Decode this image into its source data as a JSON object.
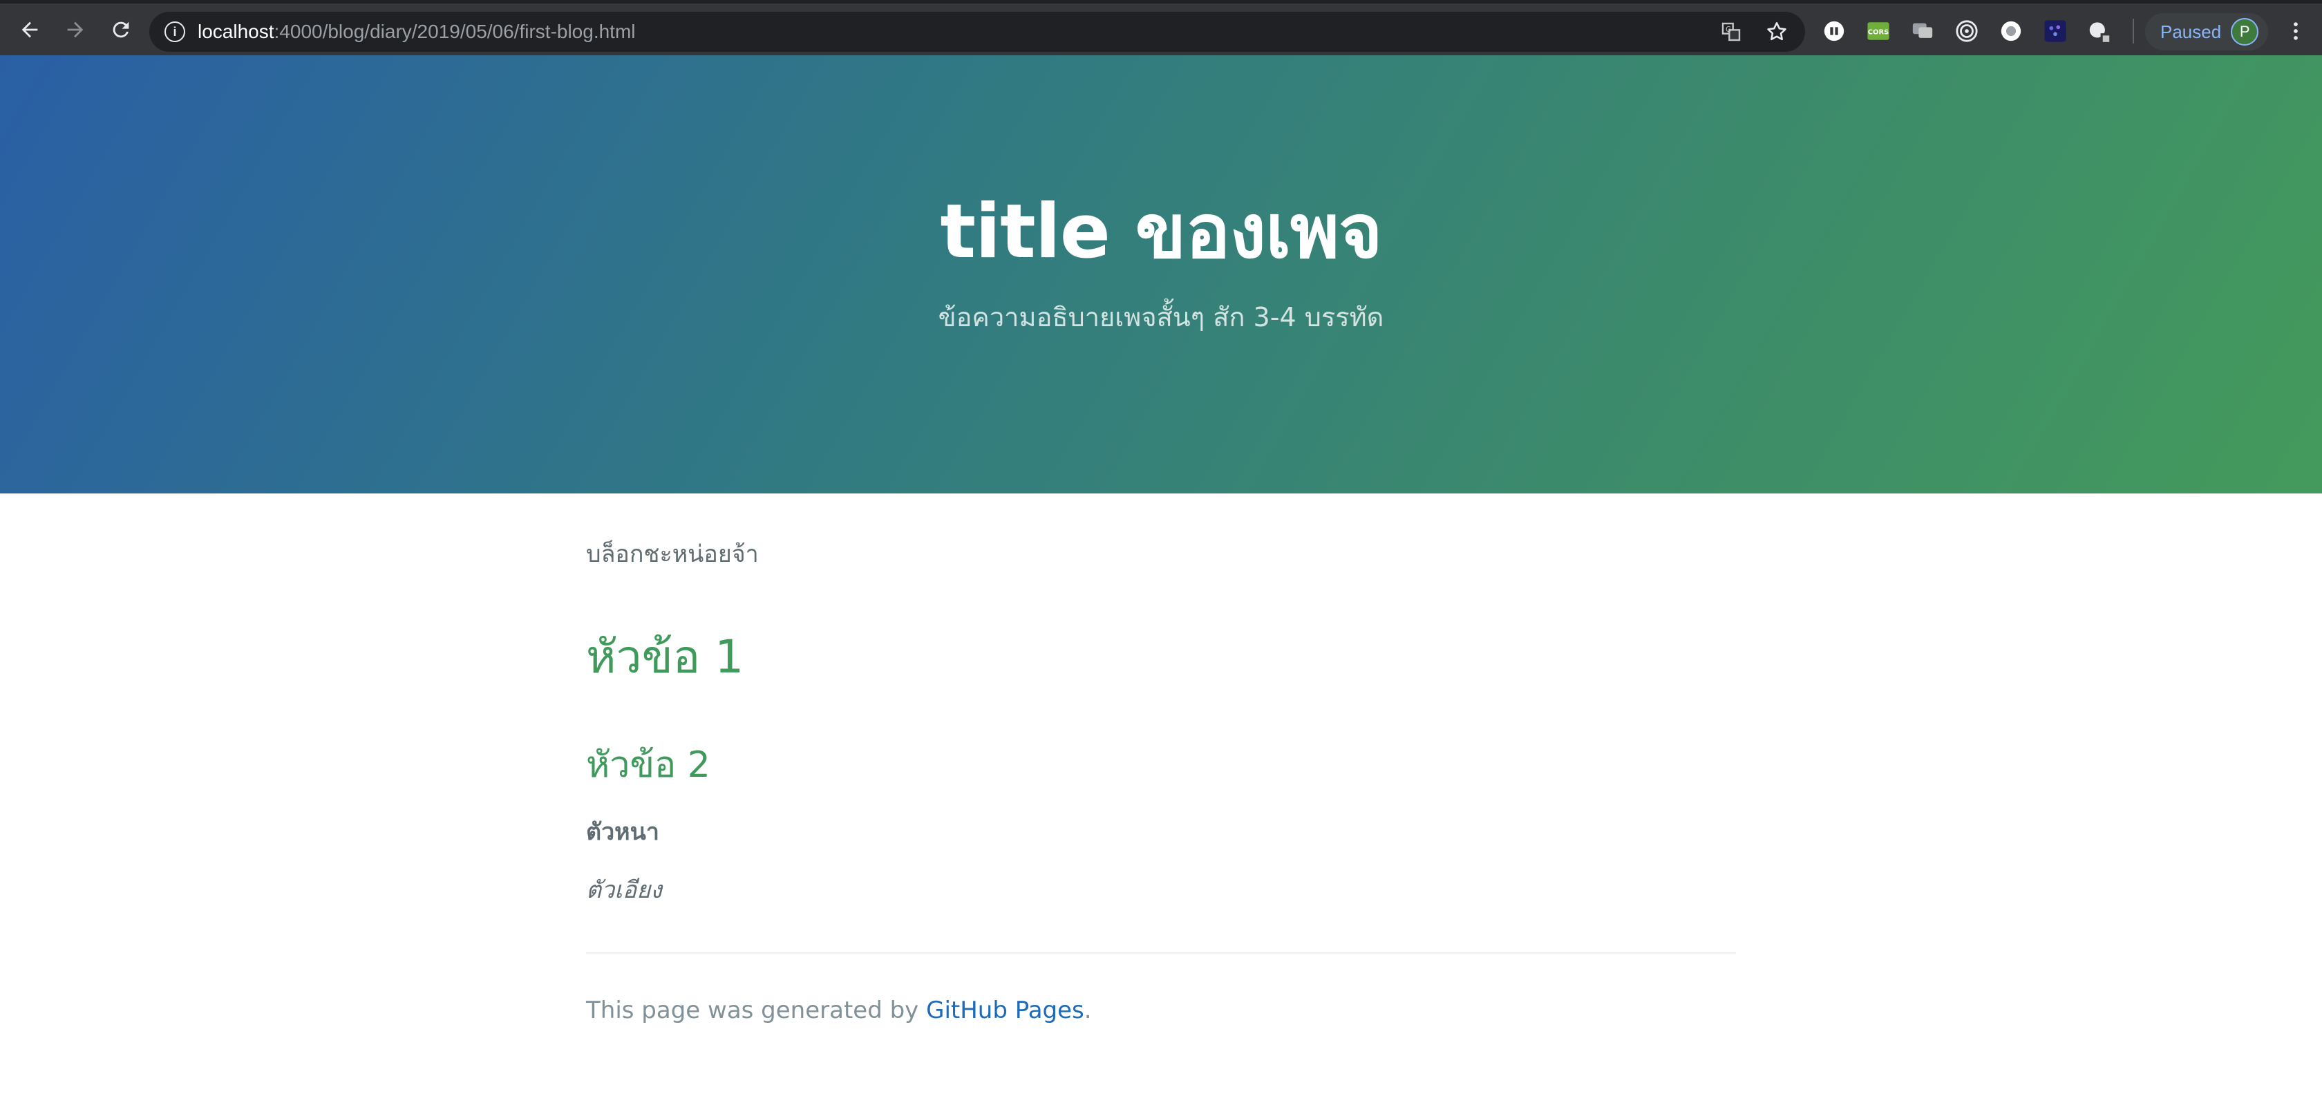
{
  "browser": {
    "url_host": "localhost",
    "url_rest": ":4000/blog/diary/2019/05/06/first-blog.html",
    "profile_status": "Paused",
    "profile_initial": "P",
    "extensions": [
      "extension-icon-1",
      "cors-extension-icon",
      "chat-extension-icon",
      "target-extension-icon",
      "circle-extension-icon",
      "dots-extension-icon",
      "cloud-extension-icon"
    ]
  },
  "header": {
    "title": "title ของเพจ",
    "tagline": "ข้อความอธิบายเพจสั้นๆ สัก 3-4 บรรทัด"
  },
  "content": {
    "intro": "บล็อกชะหน่อยจ้า",
    "heading1": "หัวข้อ 1",
    "heading2": "หัวข้อ 2",
    "bold": "ตัวหนา",
    "italic": "ตัวเอียง"
  },
  "footer": {
    "prefix": "This page was generated by ",
    "link_text": "GitHub Pages",
    "suffix": "."
  },
  "colors": {
    "chrome_bg": "#35363a",
    "header_gradient_start": "#2a5fa5",
    "header_gradient_end": "#449a5c",
    "heading_green": "#3f9a5c",
    "body_text": "#606c71",
    "link_blue": "#1e6bb8"
  }
}
